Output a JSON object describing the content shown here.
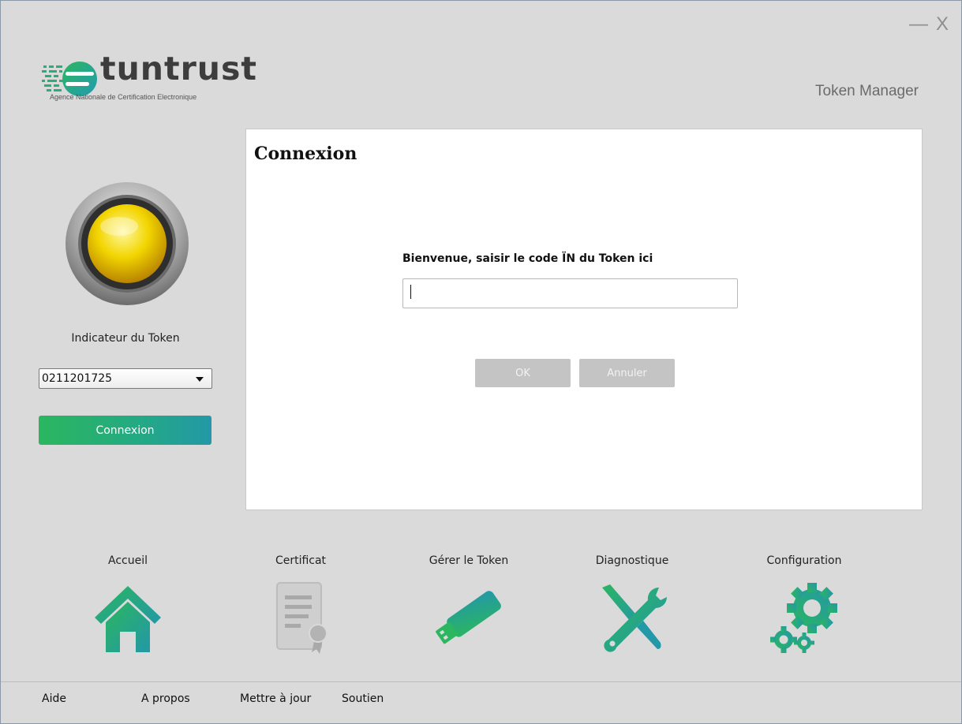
{
  "window": {
    "minimize_label": "—",
    "close_label": "X"
  },
  "brand": {
    "name": "tuntrust",
    "subtitle": "Agence Nationale de Certification Electronique",
    "app_title": "Token Manager"
  },
  "sidebar": {
    "indicator_label": "Indicateur du Token",
    "indicator_color": "#f2d500",
    "token_select_value": "0211201725",
    "connect_label": "Connexion"
  },
  "panel": {
    "title": "Connexion",
    "prompt": "Bienvenue, saisir le code ÏN du Token ici",
    "pin_value": "",
    "ok_label": "OK",
    "cancel_label": "Annuler"
  },
  "nav": {
    "items": [
      {
        "label": "Accueil",
        "icon": "home-icon"
      },
      {
        "label": "Certificat",
        "icon": "certificate-icon"
      },
      {
        "label": "Gérer le Token",
        "icon": "usb-token-icon"
      },
      {
        "label": "Diagnostique",
        "icon": "tools-icon"
      },
      {
        "label": "Configuration",
        "icon": "gears-icon"
      }
    ]
  },
  "footer": {
    "links": [
      "Aide",
      "A propos",
      "Mettre à jour",
      "Soutien"
    ]
  },
  "colors": {
    "accent_green": "#2bb65f",
    "accent_teal": "#2398a7",
    "disabled_gray": "#c4c4c4"
  }
}
